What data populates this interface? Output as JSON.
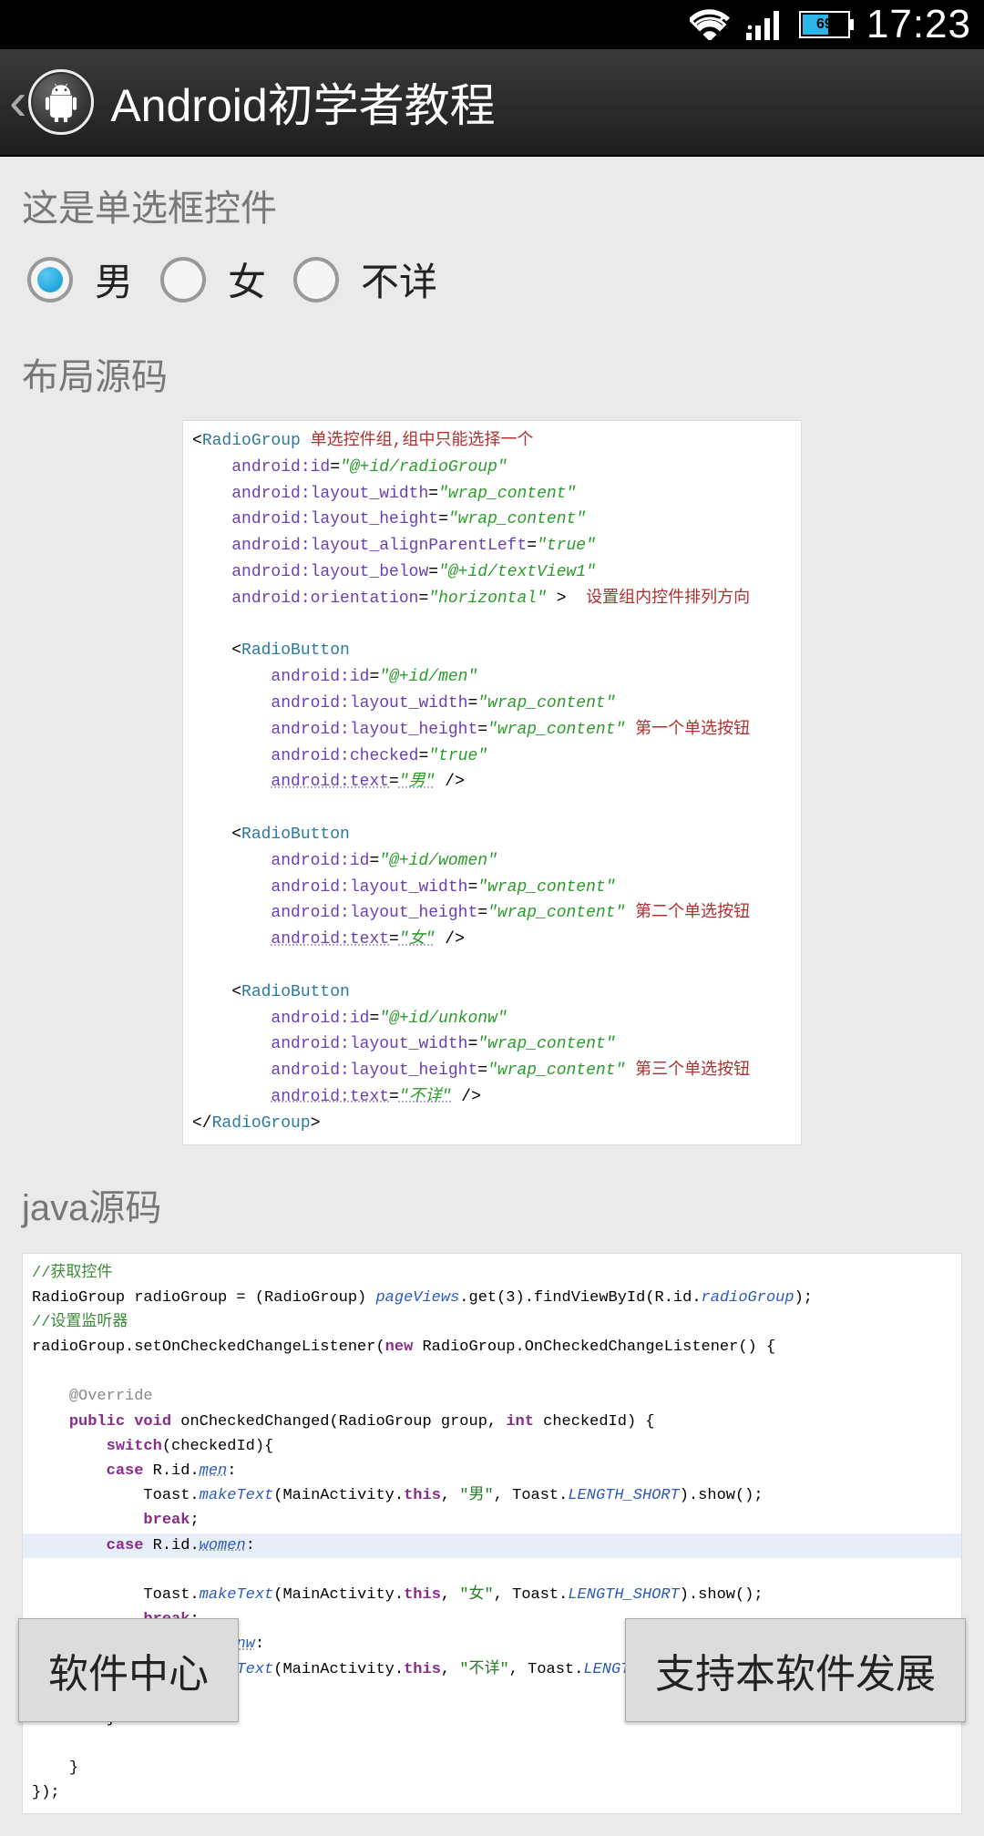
{
  "status": {
    "battery_pct": "69",
    "time": "17:23"
  },
  "actionbar": {
    "title": "Android初学者教程"
  },
  "section1": {
    "label": "这是单选框控件",
    "radios": [
      {
        "label": "男",
        "checked": true
      },
      {
        "label": "女",
        "checked": false
      },
      {
        "label": "不详",
        "checked": false
      }
    ]
  },
  "section2": {
    "label": "布局源码"
  },
  "xml": {
    "anno_group": "单选控件组,组中只能选择一个",
    "anno_orient": "设置组内控件排列方向",
    "anno_r1": "第一个单选按钮",
    "anno_r2": "第二个单选按钮",
    "anno_r3": "第三个单选按钮",
    "radiogroup_open": "RadioGroup",
    "id": "android:id",
    "id_v": "\"@+id/radioGroup\"",
    "lw": "android:layout_width",
    "wc": "\"wrap_content\"",
    "lh": "android:layout_height",
    "apl": "android:layout_alignParentLeft",
    "true_v": "\"true\"",
    "below": "android:layout_below",
    "below_v": "\"@+id/textView1\"",
    "orient": "android:orientation",
    "orient_v": "\"horizontal\"",
    "rb": "RadioButton",
    "r1_id": "\"@+id/men\"",
    "r1_txt": "\"男\"",
    "checked": "android:checked",
    "text": "android:text",
    "r2_id": "\"@+id/women\"",
    "r2_txt": "\"女\"",
    "r3_id": "\"@+id/unkonw\"",
    "r3_txt": "\"不详\"",
    "radiogroup_close": "RadioGroup"
  },
  "section3": {
    "label": "java源码"
  },
  "java": {
    "c1": "//获取控件",
    "l1a": "RadioGroup radioGroup = (RadioGroup) ",
    "l1b": "pageViews",
    "l1c": ".get(3).findViewById(R.id.",
    "l1d": "radioGroup",
    "l1e": ");",
    "c2": "//设置监听器",
    "l2a": "radioGroup.setOnCheckedChangeListener(",
    "l2b": "new",
    "l2c": " RadioGroup.OnCheckedChangeListener() {",
    "ov": "@Override",
    "pub": "public",
    "void": "void",
    "sig": " onCheckedChanged(RadioGroup group, ",
    "int": "int",
    "sig2": " checkedId) {",
    "sw": "switch",
    "swa": "(checkedId){",
    "case": "case",
    "rid": " R.id.",
    "men": "men",
    "women": "women",
    "unkonw": "unkonw",
    "toast_a": "Toast.",
    "mk": "makeText",
    "toast_b": "(MainActivity.",
    "this": "this",
    "comma": ", ",
    "s1": "\"男\"",
    "s2": "\"女\"",
    "s3": "\"不详\"",
    "toast_c": ", Toast.",
    "ls": "LENGTH_SHORT",
    "toast_d": ").show();",
    "break": "break",
    "close1": "}",
    "close2": "});"
  },
  "buttons": {
    "left": "软件中心",
    "right": "支持本软件发展"
  }
}
